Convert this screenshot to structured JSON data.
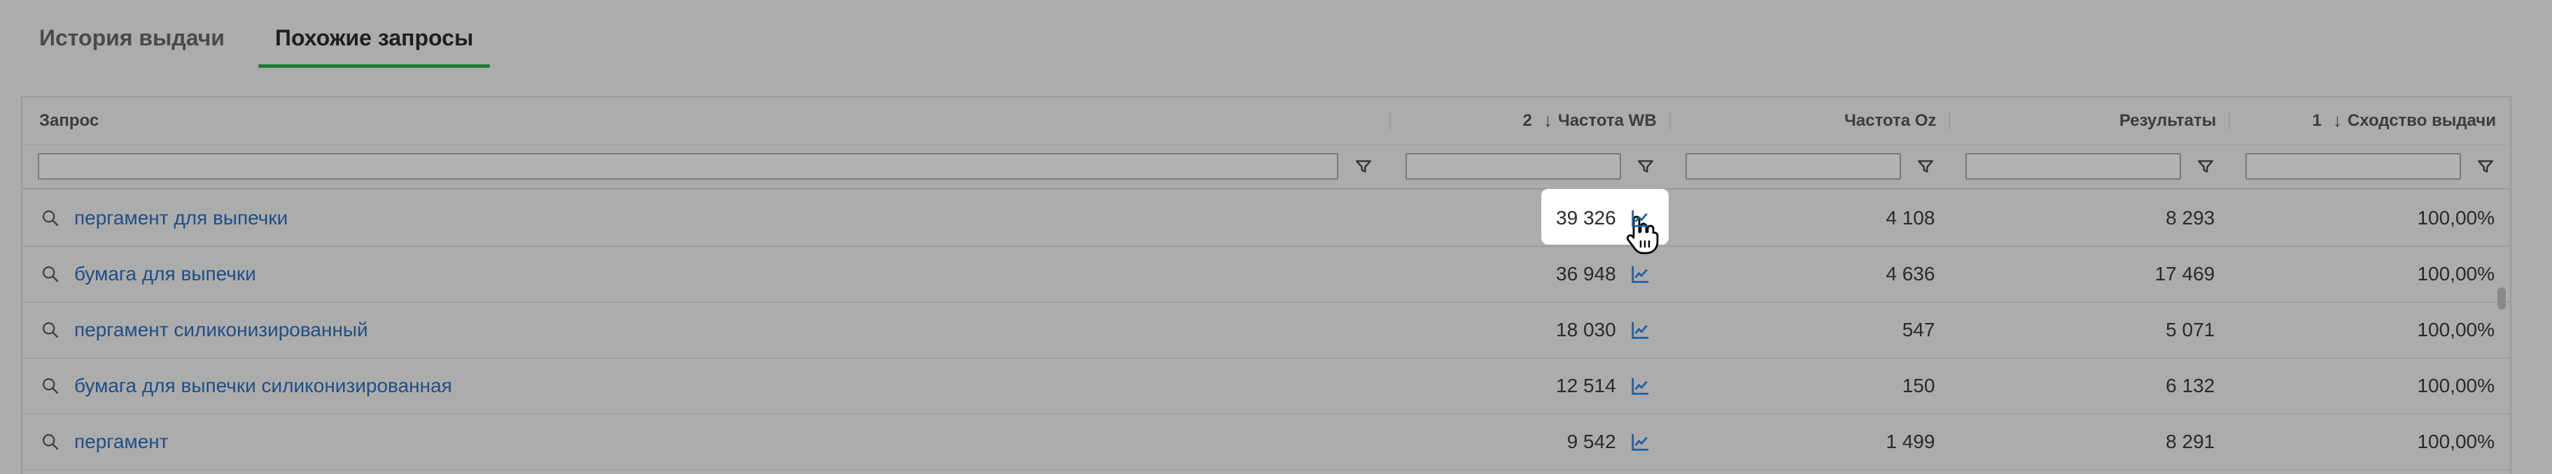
{
  "tabs": [
    {
      "label": "История выдачи",
      "active": false
    },
    {
      "label": "Похожие запросы",
      "active": true
    }
  ],
  "columns": {
    "query": {
      "label": "Запрос"
    },
    "wb": {
      "label": "Частота WB",
      "sort_index": "2",
      "sort_dir": "↓"
    },
    "oz": {
      "label": "Частота Oz"
    },
    "results": {
      "label": "Результаты"
    },
    "similarity": {
      "label": "Сходство выдачи",
      "sort_index": "1",
      "sort_dir": "↓"
    }
  },
  "filters": {
    "query": "",
    "wb": "",
    "oz": "",
    "results": "",
    "similarity": ""
  },
  "rows": [
    {
      "query": "пергамент для выпечки",
      "wb": "39 326",
      "oz": "4 108",
      "results": "8 293",
      "similarity": "100,00%"
    },
    {
      "query": "бумага для выпечки",
      "wb": "36 948",
      "oz": "4 636",
      "results": "17 469",
      "similarity": "100,00%"
    },
    {
      "query": "пергамент силиконизированный",
      "wb": "18 030",
      "oz": "547",
      "results": "5 071",
      "similarity": "100,00%"
    },
    {
      "query": "бумага для выпечки силиконизированная",
      "wb": "12 514",
      "oz": "150",
      "results": "6 132",
      "similarity": "100,00%"
    },
    {
      "query": "пергамент",
      "wb": "9 542",
      "oz": "1 499",
      "results": "8 291",
      "similarity": "100,00%"
    }
  ],
  "colors": {
    "link": "#1d4f87",
    "active_tab_underline": "#1e7a2e",
    "chart_icon": "#1d5fa3",
    "highlight": "#ffffff"
  },
  "icons": {
    "row_search": "search-icon",
    "filter": "filter-icon",
    "chart": "line-chart-icon",
    "cursor": "hand-pointer-icon"
  }
}
